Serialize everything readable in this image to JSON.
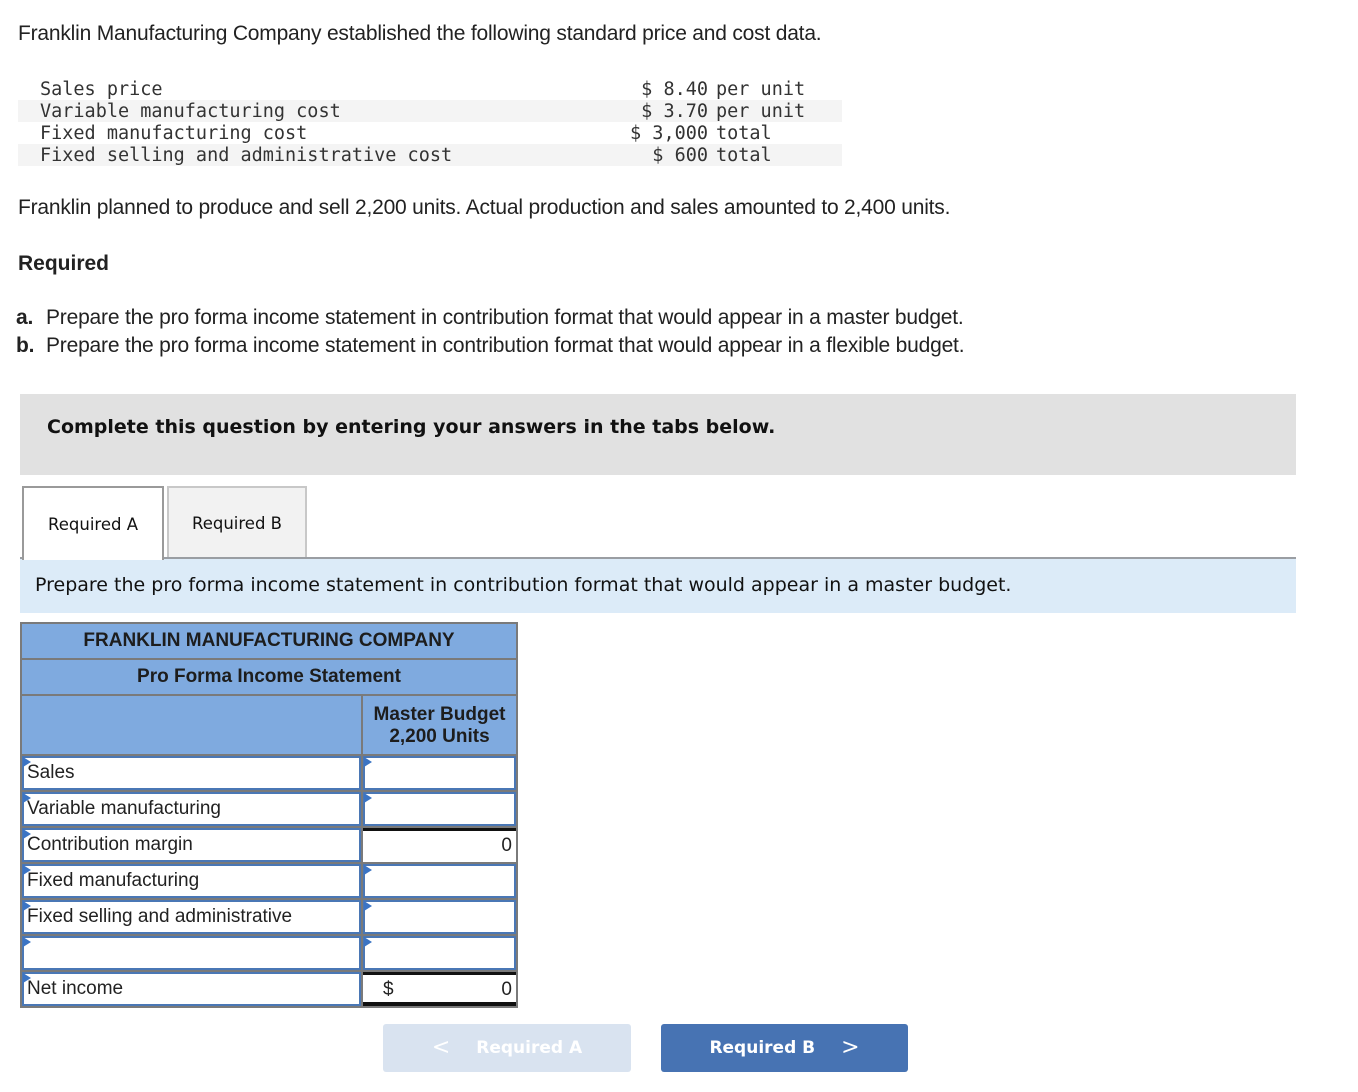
{
  "intro": "Franklin Manufacturing Company established the following standard price and cost data.",
  "cost_data": [
    {
      "label": "Sales price",
      "value": "$ 8.40",
      "unit": "per unit"
    },
    {
      "label": "Variable manufacturing cost",
      "value": "$ 3.70",
      "unit": "per unit"
    },
    {
      "label": "Fixed manufacturing cost",
      "value": "$ 3,000",
      "unit": "total"
    },
    {
      "label": "Fixed selling and administrative cost",
      "value": "$ 600",
      "unit": "total"
    }
  ],
  "planned_text": "Franklin planned to produce and sell 2,200 units. Actual production and sales amounted to 2,400 units.",
  "required_heading": "Required",
  "requirements": [
    {
      "letter": "a.",
      "text": "Prepare the pro forma income statement in contribution format that would appear in a master budget."
    },
    {
      "letter": "b.",
      "text": "Prepare the pro forma income statement in contribution format that would appear in a flexible budget."
    }
  ],
  "instruction": "Complete this question by entering your answers in the tabs below.",
  "tabs": [
    {
      "label": "Required A",
      "active": true
    },
    {
      "label": "Required B",
      "active": false
    }
  ],
  "prompt": "Prepare the pro forma income statement in contribution format that would appear in a master budget.",
  "statement": {
    "company": "FRANKLIN MANUFACTURING COMPANY",
    "title": "Pro Forma Income Statement",
    "column_header_line1": "Master Budget",
    "column_header_line2": "2,200 Units",
    "rows": [
      {
        "label": "Sales",
        "value": "",
        "currency": ""
      },
      {
        "label": "Variable manufacturing",
        "value": "",
        "currency": ""
      },
      {
        "label": "Contribution margin",
        "value": "0",
        "currency": ""
      },
      {
        "label": "Fixed manufacturing",
        "value": "",
        "currency": ""
      },
      {
        "label": "Fixed selling and administrative",
        "value": "",
        "currency": ""
      },
      {
        "label": "",
        "value": "",
        "currency": ""
      },
      {
        "label": "Net income",
        "value": "0",
        "currency": "$"
      }
    ]
  },
  "navigation": {
    "prev_label": "Required A",
    "next_label": "Required B",
    "prev_icon": "<",
    "next_icon": ">"
  }
}
